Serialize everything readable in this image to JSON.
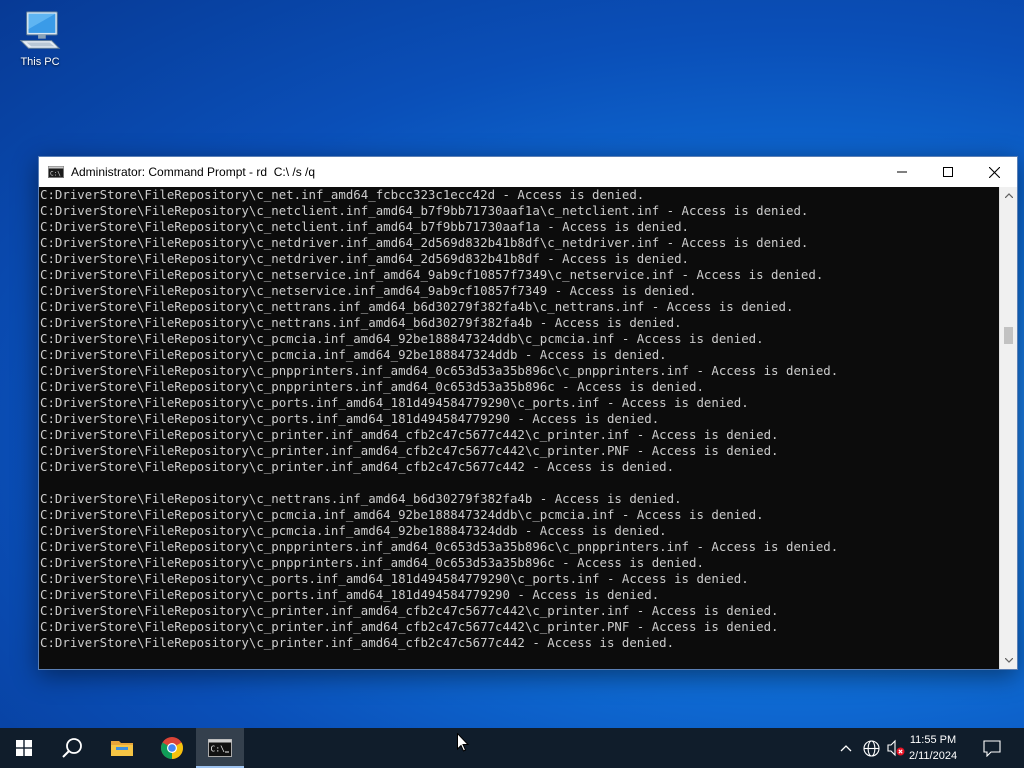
{
  "desktop": {
    "icons": [
      {
        "label": "This PC",
        "icon": "this-pc-icon"
      }
    ]
  },
  "window": {
    "title": "Administrator: Command Prompt - rd  C:\\ /s /q",
    "controls": [
      "minimize-icon",
      "maximize-icon",
      "close-icon"
    ],
    "console_lines": [
      "C:DriverStore\\FileRepository\\c_net.inf_amd64_fcbcc323c1ecc42d - Access is denied.",
      "C:DriverStore\\FileRepository\\c_netclient.inf_amd64_b7f9bb71730aaf1a\\c_netclient.inf - Access is denied.",
      "C:DriverStore\\FileRepository\\c_netclient.inf_amd64_b7f9bb71730aaf1a - Access is denied.",
      "C:DriverStore\\FileRepository\\c_netdriver.inf_amd64_2d569d832b41b8df\\c_netdriver.inf - Access is denied.",
      "C:DriverStore\\FileRepository\\c_netdriver.inf_amd64_2d569d832b41b8df - Access is denied.",
      "C:DriverStore\\FileRepository\\c_netservice.inf_amd64_9ab9cf10857f7349\\c_netservice.inf - Access is denied.",
      "C:DriverStore\\FileRepository\\c_netservice.inf_amd64_9ab9cf10857f7349 - Access is denied.",
      "C:DriverStore\\FileRepository\\c_nettrans.inf_amd64_b6d30279f382fa4b\\c_nettrans.inf - Access is denied.",
      "C:DriverStore\\FileRepository\\c_nettrans.inf_amd64_b6d30279f382fa4b - Access is denied.",
      "C:DriverStore\\FileRepository\\c_pcmcia.inf_amd64_92be188847324ddb\\c_pcmcia.inf - Access is denied.",
      "C:DriverStore\\FileRepository\\c_pcmcia.inf_amd64_92be188847324ddb - Access is denied.",
      "C:DriverStore\\FileRepository\\c_pnpprinters.inf_amd64_0c653d53a35b896c\\c_pnpprinters.inf - Access is denied.",
      "C:DriverStore\\FileRepository\\c_pnpprinters.inf_amd64_0c653d53a35b896c - Access is denied.",
      "C:DriverStore\\FileRepository\\c_ports.inf_amd64_181d494584779290\\c_ports.inf - Access is denied.",
      "C:DriverStore\\FileRepository\\c_ports.inf_amd64_181d494584779290 - Access is denied.",
      "C:DriverStore\\FileRepository\\c_printer.inf_amd64_cfb2c47c5677c442\\c_printer.inf - Access is denied.",
      "C:DriverStore\\FileRepository\\c_printer.inf_amd64_cfb2c47c5677c442\\c_printer.PNF - Access is denied.",
      "C:DriverStore\\FileRepository\\c_printer.inf_amd64_cfb2c47c5677c442 - Access is denied.",
      "",
      "C:DriverStore\\FileRepository\\c_nettrans.inf_amd64_b6d30279f382fa4b - Access is denied.",
      "C:DriverStore\\FileRepository\\c_pcmcia.inf_amd64_92be188847324ddb\\c_pcmcia.inf - Access is denied.",
      "C:DriverStore\\FileRepository\\c_pcmcia.inf_amd64_92be188847324ddb - Access is denied.",
      "C:DriverStore\\FileRepository\\c_pnpprinters.inf_amd64_0c653d53a35b896c\\c_pnpprinters.inf - Access is denied.",
      "C:DriverStore\\FileRepository\\c_pnpprinters.inf_amd64_0c653d53a35b896c - Access is denied.",
      "C:DriverStore\\FileRepository\\c_ports.inf_amd64_181d494584779290\\c_ports.inf - Access is denied.",
      "C:DriverStore\\FileRepository\\c_ports.inf_amd64_181d494584779290 - Access is denied.",
      "C:DriverStore\\FileRepository\\c_printer.inf_amd64_cfb2c47c5677c442\\c_printer.inf - Access is denied.",
      "C:DriverStore\\FileRepository\\c_printer.inf_amd64_cfb2c47c5677c442\\c_printer.PNF - Access is denied.",
      "C:DriverStore\\FileRepository\\c_printer.inf_amd64_cfb2c47c5677c442 - Access is denied."
    ]
  },
  "taskbar": {
    "pinned": [
      "start-windows-icon",
      "search-icon",
      "file-explorer-icon",
      "chrome-icon",
      "command-prompt-icon"
    ],
    "active": "command-prompt-icon",
    "tray_icons": [
      "show-hidden-icons-chevron",
      "network-globe-icon",
      "volume-muted-icon",
      "notifications-icon"
    ],
    "clock": {
      "time": "11:55 PM",
      "date": "2/11/2024"
    }
  },
  "colors": {
    "console_bg": "#0c0c0c",
    "console_text": "#cccccc",
    "taskbar_bg": "#101d2b",
    "desktop_accent": "#0f6fd8"
  }
}
